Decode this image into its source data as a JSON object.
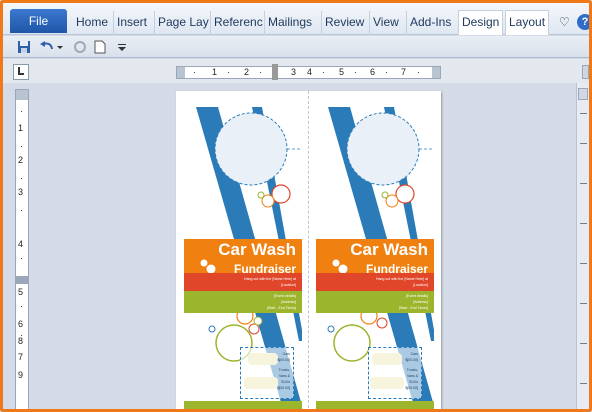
{
  "ribbon": {
    "file_tab": "File",
    "tabs": [
      "Home",
      "Insert",
      "Page Lay",
      "Referenc",
      "Mailings",
      "Review",
      "View",
      "Add-Ins",
      "Design",
      "Layout"
    ]
  },
  "ruler": {
    "horizontal_numbers": [
      "1",
      "2",
      "3",
      "4",
      "5",
      "6",
      "7"
    ],
    "vertical_numbers": [
      "1",
      "2",
      "3",
      "4",
      "5",
      "6",
      "7",
      "8",
      "9"
    ]
  },
  "flyer": {
    "title": "Car Wash",
    "subtitle": "Fundraiser",
    "red_band_lines": [
      "Hang out with the [Name Here] at",
      "[Location]"
    ],
    "green_band_lines": [
      "[Event details]",
      "[Address]",
      "[Start - End Times]"
    ],
    "info_lines": [
      "Cars",
      "$[00.00]",
      "Trucks,",
      "Vans &",
      "SUVs",
      "$[00.00]"
    ]
  },
  "colors": {
    "orange": "#f08010",
    "red": "#e0462a",
    "green": "#9bb52d",
    "blue": "#2b7bb8",
    "frame": "#f07818"
  }
}
